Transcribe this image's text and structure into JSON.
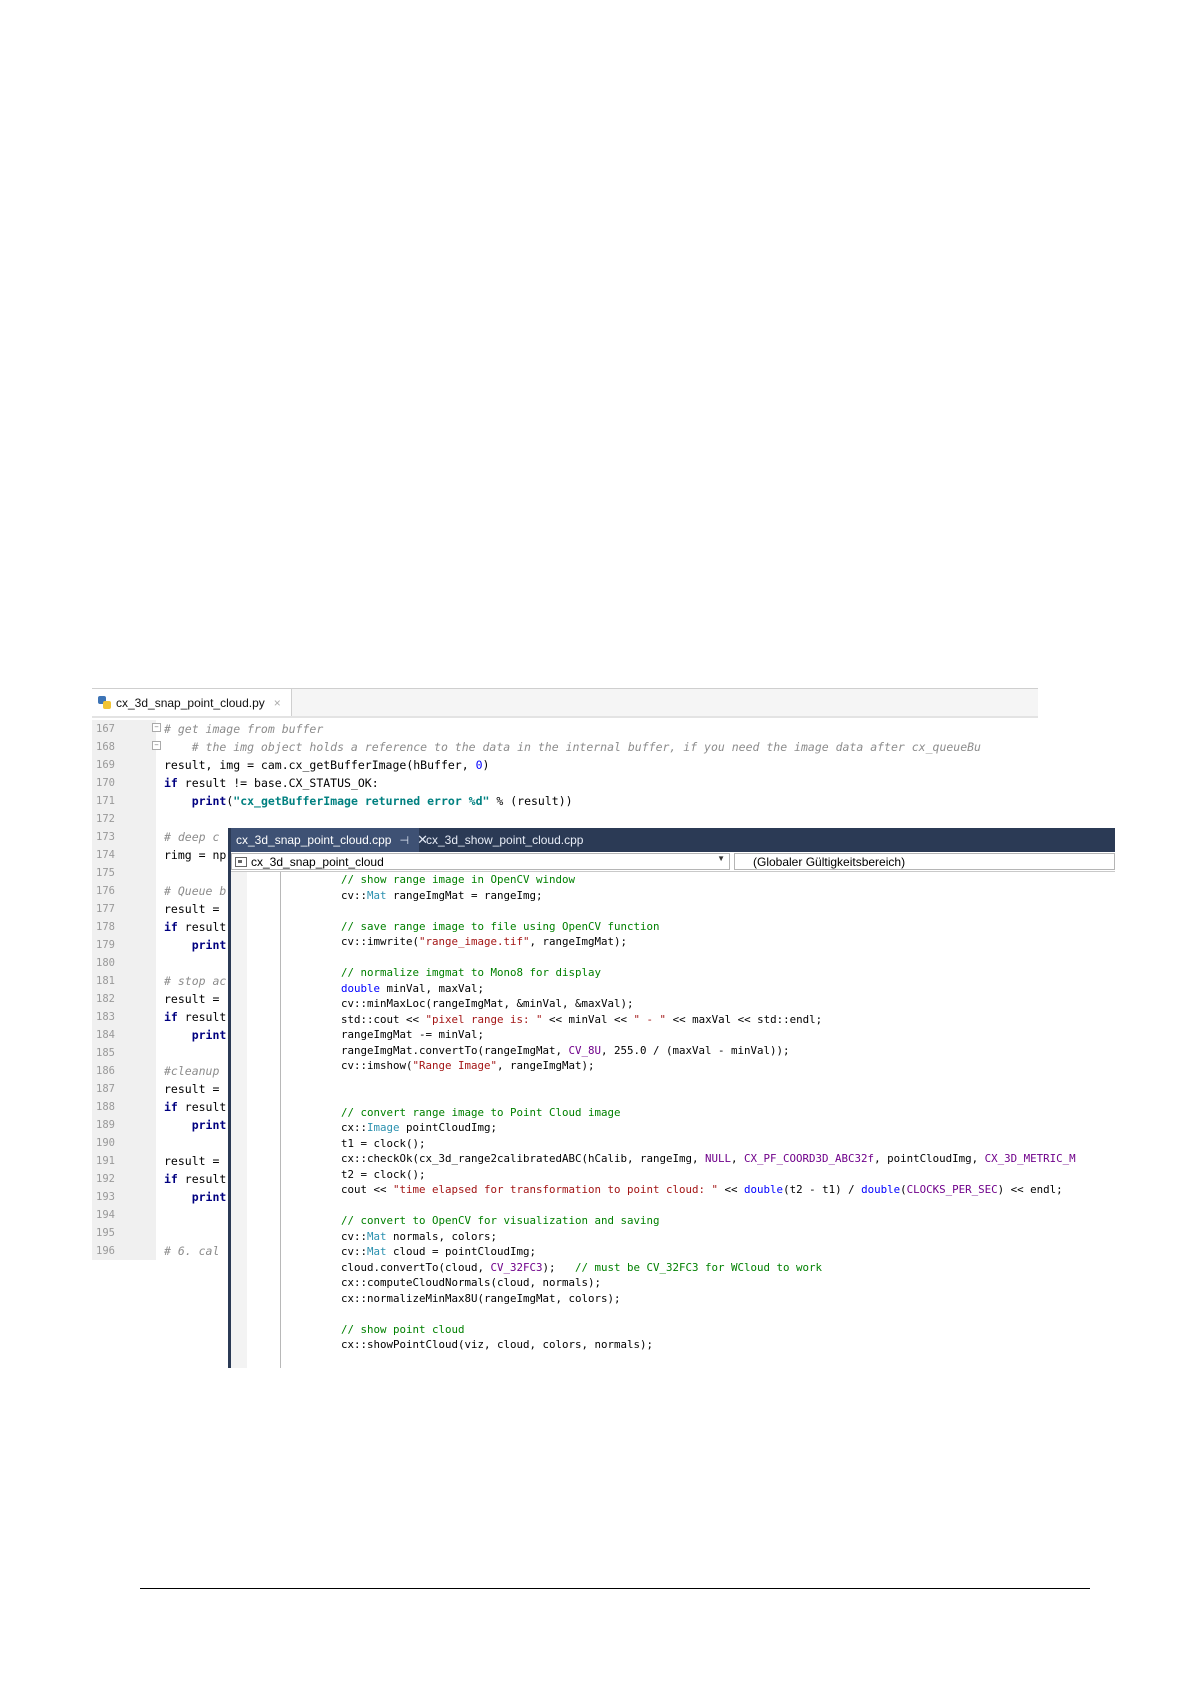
{
  "python_editor": {
    "tab_label": "cx_3d_snap_point_cloud.py",
    "close_glyph": "×",
    "lines": [
      {
        "num": "167",
        "text": "# get image from buffer",
        "style": "comment"
      },
      {
        "num": "168",
        "text": "    # the img object holds a reference to the data in the internal buffer, if you need the image data after cx_queueBu",
        "style": "comment"
      },
      {
        "num": "169",
        "text": "result, img = cam.cx_getBufferImage(hBuffer, 0)",
        "style": "code"
      },
      {
        "num": "170",
        "text": "if result != base.CX_STATUS_OK:",
        "style": "code"
      },
      {
        "num": "171",
        "text": "    print(\"cx_getBufferImage returned error %d\" % (result))",
        "style": "code"
      },
      {
        "num": "172",
        "text": "",
        "style": "code"
      },
      {
        "num": "173",
        "text": "# deep c",
        "style": "comment"
      },
      {
        "num": "174",
        "text": "rimg = np",
        "style": "code"
      },
      {
        "num": "175",
        "text": "",
        "style": "code"
      },
      {
        "num": "176",
        "text": "# Queue b",
        "style": "comment"
      },
      {
        "num": "177",
        "text": "result =",
        "style": "code"
      },
      {
        "num": "178",
        "text": "if result",
        "style": "code"
      },
      {
        "num": "179",
        "text": "    print",
        "style": "code"
      },
      {
        "num": "180",
        "text": "",
        "style": "code"
      },
      {
        "num": "181",
        "text": "# stop ac",
        "style": "comment"
      },
      {
        "num": "182",
        "text": "result =",
        "style": "code"
      },
      {
        "num": "183",
        "text": "if result",
        "style": "code"
      },
      {
        "num": "184",
        "text": "    print",
        "style": "code"
      },
      {
        "num": "185",
        "text": "",
        "style": "code"
      },
      {
        "num": "186",
        "text": "#cleanup",
        "style": "comment"
      },
      {
        "num": "187",
        "text": "result =",
        "style": "code"
      },
      {
        "num": "188",
        "text": "if result",
        "style": "code"
      },
      {
        "num": "189",
        "text": "    print",
        "style": "code"
      },
      {
        "num": "190",
        "text": "",
        "style": "code"
      },
      {
        "num": "191",
        "text": "result =",
        "style": "code"
      },
      {
        "num": "192",
        "text": "if result",
        "style": "code"
      },
      {
        "num": "193",
        "text": "    print",
        "style": "code"
      },
      {
        "num": "194",
        "text": "",
        "style": "code"
      },
      {
        "num": "195",
        "text": "",
        "style": "code"
      },
      {
        "num": "196",
        "text": "# 6. cal",
        "style": "comment"
      }
    ]
  },
  "vs_editor": {
    "active_tab": "cx_3d_snap_point_cloud.cpp",
    "pin_glyph": "⊣",
    "close_glyph": "✕",
    "inactive_tab": "cx_3d_show_point_cloud.cpp",
    "scope_left": "cx_3d_snap_point_cloud",
    "scope_right": "(Globaler Gültigkeitsbereich)",
    "dropdown_glyph": "▼",
    "lines": [
      "// show range image in OpenCV window",
      "cv::Mat rangeImgMat = rangeImg;",
      "",
      "// save range image to file using OpenCV function",
      "cv::imwrite(\"range_image.tif\", rangeImgMat);",
      "",
      "// normalize imgmat to Mono8 for display",
      "double minVal, maxVal;",
      "cv::minMaxLoc(rangeImgMat, &minVal, &maxVal);",
      "std::cout << \"pixel range is: \" << minVal << \" - \" << maxVal << std::endl;",
      "rangeImgMat -= minVal;",
      "rangeImgMat.convertTo(rangeImgMat, CV_8U, 255.0 / (maxVal - minVal));",
      "cv::imshow(\"Range Image\", rangeImgMat);",
      "",
      "",
      "// convert range image to Point Cloud image",
      "cx::Image pointCloudImg;",
      "t1 = clock();",
      "cx::checkOk(cx_3d_range2calibratedABC(hCalib, rangeImg, NULL, CX_PF_COORD3D_ABC32f, pointCloudImg, CX_3D_METRIC_M",
      "t2 = clock();",
      "cout << \"time elapsed for transformation to point cloud: \" << double(t2 - t1) / double(CLOCKS_PER_SEC) << endl;",
      "",
      "// convert to OpenCV for visualization and saving",
      "cv::Mat normals, colors;",
      "cv::Mat cloud = pointCloudImg;",
      "cloud.convertTo(cloud, CV_32FC3);   // must be CV_32FC3 for WCloud to work",
      "cx::computeCloudNormals(cloud, normals);",
      "cx::normalizeMinMax8U(rangeImgMat, colors);",
      "",
      "// show point cloud",
      "cx::showPointCloud(viz, cloud, colors, normals);"
    ]
  },
  "colors": {
    "vs_title_bar": "#2b3a55",
    "vs_active_tab": "#3e5174",
    "cpp_comment": "#008000",
    "cpp_keyword": "#0000ff",
    "cpp_type": "#2b91af",
    "cpp_string": "#a31515",
    "cpp_macro": "#6f008a"
  }
}
